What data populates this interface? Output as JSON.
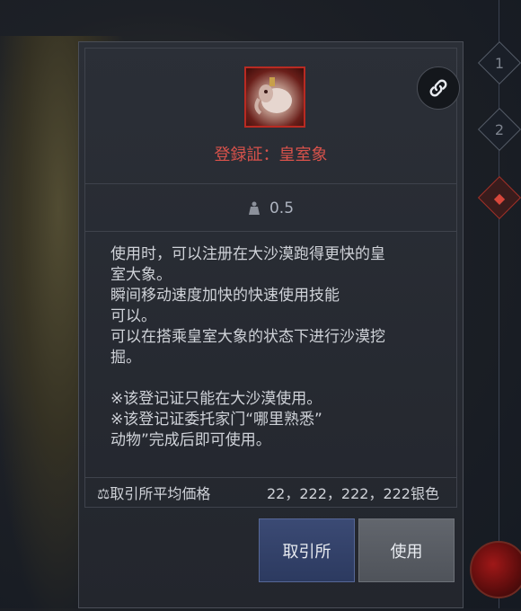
{
  "item": {
    "name": "登録証：皇室象",
    "icon": "royal-elephant-item-icon",
    "weight": "0.5",
    "description_lines": [
      "使用时，可以注册在大沙漠跑得更快的皇",
      "室大象。",
      "瞬间移动速度加快的快速使用技能",
      "可以。",
      "可以在搭乘皇室大象的状态下进行沙漠挖",
      "掘。",
      "",
      "※该登记证只能在大沙漠使用。",
      "※该登记证委托家门“哪里熟悉”",
      "动物”完成后即可使用。"
    ]
  },
  "price": {
    "label": "取引所平均価格",
    "value": "22，222，222，222银色"
  },
  "buttons": {
    "exchange": "取引所",
    "use": "使用"
  },
  "side_rail": {
    "nodes": [
      "1",
      "2",
      "◆"
    ]
  },
  "colors": {
    "item_name": "#d9524b",
    "exchange_button": "#34426a",
    "use_button": "#575b62",
    "icon_border": "#b92a22"
  }
}
